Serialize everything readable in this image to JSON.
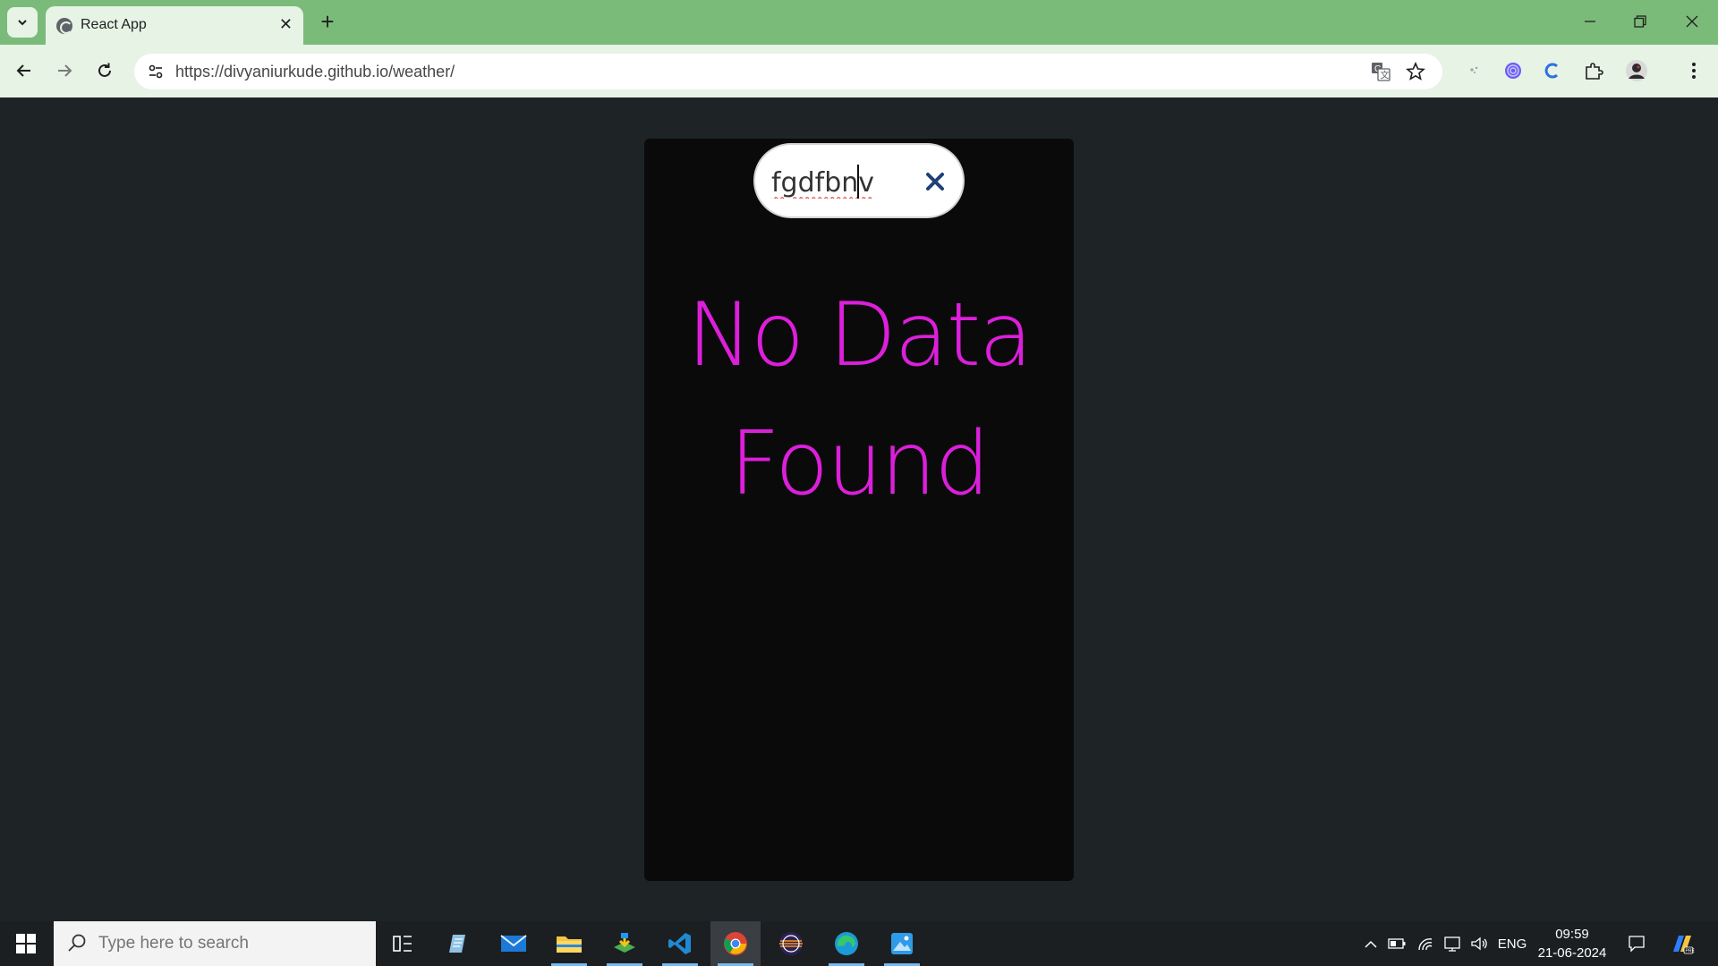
{
  "browser": {
    "tab": {
      "title": "React App",
      "favicon": "globe-icon"
    },
    "url": "https://divyaniurkude.github.io/weather/",
    "window_controls": [
      "minimize-icon",
      "restore-icon",
      "close-icon"
    ]
  },
  "page": {
    "search": {
      "value": "fgdfbnv",
      "clear_icon": "close-x-icon"
    },
    "message_line1": "No Data",
    "message_line2": "Found",
    "colors": {
      "message": "#dc1fdb",
      "card": "#0a0a0a",
      "background": "#1e2425"
    }
  },
  "taskbar": {
    "search_placeholder": "Type here to search",
    "apps": [
      "task-view",
      "notepad",
      "mail",
      "file-explorer",
      "installer",
      "vscode",
      "chrome",
      "eclipse",
      "edge",
      "photos"
    ],
    "language": "ENG",
    "time": "09:59",
    "date": "21-06-2024"
  }
}
